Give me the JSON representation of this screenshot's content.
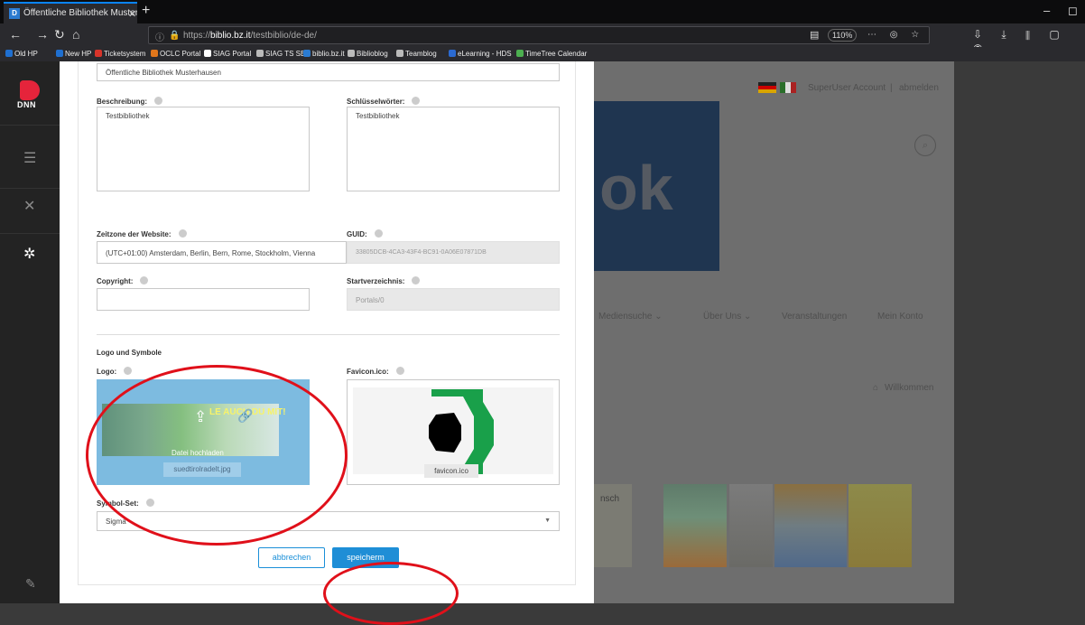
{
  "browser": {
    "tab_title": "Öffentliche Bibliothek Musterh",
    "url_prefix": "https://",
    "url_host": "biblio.bz.it",
    "url_path": "/testbiblio/de-de/",
    "zoom": "110%",
    "bookmarks": [
      {
        "label": "Old HP",
        "color": "#1f6fd0"
      },
      {
        "label": "New HP",
        "color": "#1f6fd0"
      },
      {
        "label": "Ticketsystem",
        "color": "#d8342a"
      },
      {
        "label": "OCLC Portal",
        "color": "#e0761b"
      },
      {
        "label": "SIAG Portal",
        "color": "#ffffff"
      },
      {
        "label": "SIAG TS SB",
        "color": "#bbbbbb"
      },
      {
        "label": "biblio.bz.it",
        "color": "#2b7bd1"
      },
      {
        "label": "Biblioblog",
        "color": "#bbbbbb"
      },
      {
        "label": "Teamblog",
        "color": "#bbbbbb"
      },
      {
        "label": "eLearning - HDS",
        "color": "#2b6ad1"
      },
      {
        "label": "TimeTree Calendar",
        "color": "#4caf50"
      }
    ]
  },
  "sidebar": {
    "logo_text": "DNN"
  },
  "background_page": {
    "account": "SuperUser Account",
    "separator": "|",
    "logout": "abmelden",
    "logo_letters": "ok",
    "nav": [
      "Mediensuche ⌄",
      "Über Uns ⌄",
      "Veranstaltungen",
      "Mein Konto"
    ],
    "welcome": "Willkommen",
    "book_caption": "nsch"
  },
  "modal": {
    "site_name_value": "Öffentliche Bibliothek Musterhausen",
    "description_label": "Beschreibung:",
    "description_value": "Testbibliothek",
    "keywords_label": "Schlüsselwörter:",
    "keywords_value": "Testbibliothek",
    "timezone_label": "Zeitzone der Website:",
    "timezone_value": "(UTC+01:00) Amsterdam, Berlin, Bern, Rome, Stockholm, Vienna",
    "guid_label": "GUID:",
    "guid_value": "33805DCB-4CA3-43F4-BC91-0A06E07871DB",
    "copyright_label": "Copyright:",
    "copyright_value": "",
    "homedir_label": "Startverzeichnis:",
    "homedir_value": "Portals/0",
    "section_title": "Logo und Symbole",
    "logo_label": "Logo:",
    "logo_overlay_text": "LE AUCH DU MIT!",
    "upload_text": "Datei hochladen",
    "logo_file": "suedtirolradelt.jpg",
    "favicon_label": "Favicon.ico:",
    "favicon_file": "favicon.ico",
    "iconset_label": "Symbol-Set:",
    "iconset_value": "Sigma",
    "cancel_label": "abbrechen",
    "save_label": "speicherm"
  },
  "colors": {
    "accent": "#1f8ed6",
    "annotation": "#e0101a",
    "dnn_red": "#e5243b"
  }
}
